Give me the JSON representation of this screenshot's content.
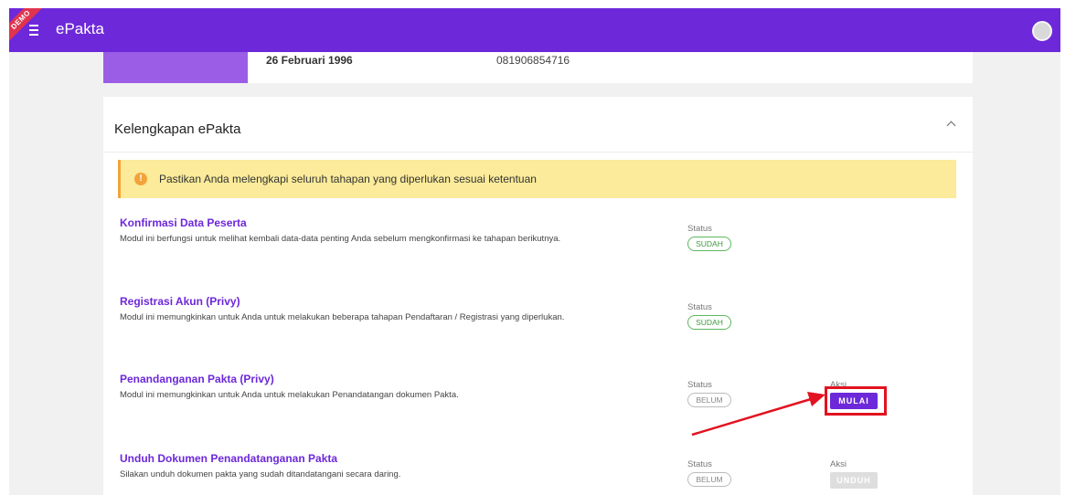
{
  "app": {
    "title": "ePakta",
    "ribbon": "DEMO"
  },
  "profile": {
    "birth_date": "26 Februari 1996",
    "phone": "081906854716"
  },
  "section": {
    "title": "Kelengkapan ePakta",
    "alert": "Pastikan Anda melengkapi seluruh tahapan yang diperlukan sesuai ketentuan",
    "modules": [
      {
        "title": "Konfirmasi Data Peserta",
        "desc": "Modul ini berfungsi untuk melihat kembali data-data penting Anda sebelum mengkonfirmasi ke tahapan berikutnya.",
        "status_label": "Status",
        "status": "SUDAH"
      },
      {
        "title": "Registrasi Akun (Privy)",
        "desc": "Modul ini memungkinkan untuk Anda untuk melakukan beberapa tahapan Pendaftaran / Registrasi yang diperlukan.",
        "status_label": "Status",
        "status": "SUDAH"
      },
      {
        "title": "Penandanganan Pakta (Privy)",
        "desc": "Modul ini memungkinkan untuk Anda untuk melakukan Penandatangan dokumen Pakta.",
        "status_label": "Status",
        "status": "BELUM",
        "action_label": "Aksi",
        "action": "MULAI"
      },
      {
        "title": "Unduh Dokumen Penandatanganan Pakta",
        "desc": "Silakan unduh dokumen pakta yang sudah ditandatangani secara daring.",
        "status_label": "Status",
        "status": "BELUM",
        "action_label": "Aksi",
        "action": "UNDUH"
      }
    ]
  },
  "colors": {
    "primary": "#6d28d9",
    "alert_bg": "#fbeb9a",
    "alert_accent": "#f2a33a",
    "success": "#5cb85c",
    "annotation": "#e3121f"
  },
  "icons": {
    "menu": "menu-icon",
    "alert": "info-icon",
    "collapse": "chevron-up-icon"
  }
}
